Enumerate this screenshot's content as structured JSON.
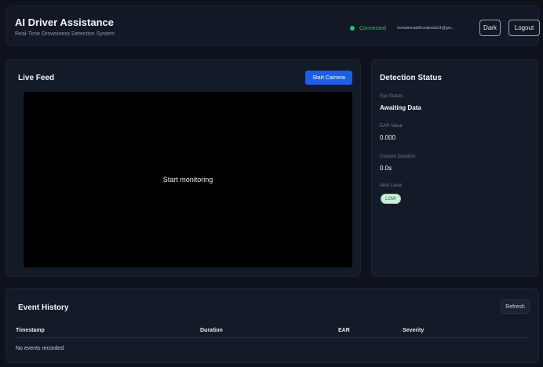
{
  "header": {
    "title": "AI Driver Assistance",
    "subtitle": "Real-Time Drowsiness Detection System",
    "connection_status": "Connected",
    "user_email": "mohammaddhorajiwala11@gm...",
    "theme_label": "Dark",
    "logout_label": "Logout",
    "status_color": "#22c55e"
  },
  "live_feed": {
    "title": "Live Feed",
    "start_label": "Start Camera",
    "placeholder": "Start monitoring",
    "accent_color": "#1d5ee6"
  },
  "detection": {
    "title": "Detection Status",
    "eye_status_label": "Eye Status",
    "eye_status_value": "Awaiting Data",
    "ear_label": "EAR Value",
    "ear_value": "0.000",
    "closure_label": "Closure Duration",
    "closure_value": "0.0s",
    "alert_label": "Alert Level",
    "alert_value": "LOW"
  },
  "events": {
    "title": "Event History",
    "refresh_label": "Refresh",
    "columns": [
      "Timestamp",
      "Duration",
      "EAR",
      "Severity"
    ],
    "empty_message": "No events recorded"
  }
}
